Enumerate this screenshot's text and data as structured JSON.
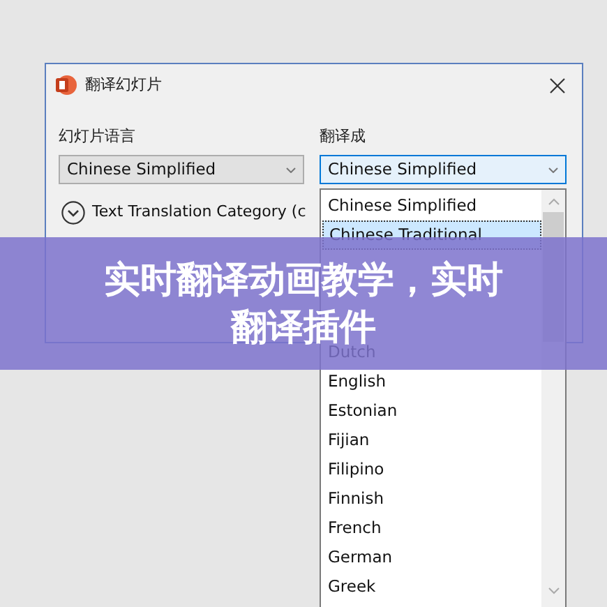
{
  "dialog": {
    "title": "翻译幻灯片",
    "fields": [
      {
        "label": "幻灯片语言",
        "value": "Chinese Simplified"
      },
      {
        "label": "翻译成",
        "value": "Chinese Simplified"
      }
    ],
    "expander": {
      "label": "Text Translation Category (c",
      "expanded": false
    }
  },
  "dropdown_list": {
    "items": [
      {
        "label": "Chinese Simplified",
        "selected": false
      },
      {
        "label": "Chinese Traditional",
        "selected": true
      },
      {
        "label": "Dutch",
        "selected": false
      },
      {
        "label": "English",
        "selected": false
      },
      {
        "label": "Estonian",
        "selected": false
      },
      {
        "label": "Fijian",
        "selected": false
      },
      {
        "label": "Filipino",
        "selected": false
      },
      {
        "label": "Finnish",
        "selected": false
      },
      {
        "label": "French",
        "selected": false
      },
      {
        "label": "German",
        "selected": false
      },
      {
        "label": "Greek",
        "selected": false
      }
    ]
  },
  "banner": {
    "text": "实时翻译动画教学，实时翻译插件"
  }
}
